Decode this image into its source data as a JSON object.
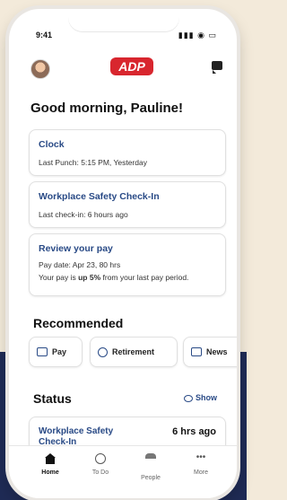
{
  "status_bar": {
    "time": "9:41",
    "icons": "▮▮▮ ◉ ▭"
  },
  "header": {
    "logo_text": "ADP"
  },
  "greeting": "Good morning, Pauline!",
  "cards": {
    "clock": {
      "title": "Clock",
      "subtitle": "Last Punch: 5:15 PM, Yesterday"
    },
    "safety": {
      "title": "Workplace Safety Check-In",
      "subtitle": "Last check-in: 6 hours ago"
    },
    "pay": {
      "title": "Review your pay",
      "line1": "Pay date: Apr 23, 80 hrs",
      "line2_prefix": "Your pay is ",
      "line2_bold": "up 5%",
      "line2_suffix": " from your last pay period."
    }
  },
  "recommended": {
    "title": "Recommended",
    "chips": [
      {
        "label": "Pay"
      },
      {
        "label": "Retirement"
      },
      {
        "label": "News"
      }
    ]
  },
  "status_section": {
    "title": "Status",
    "show_label": "Show",
    "item": {
      "title": "Workplace Safety Check-In",
      "time": "6 hrs ago"
    }
  },
  "tabs": [
    {
      "label": "Home"
    },
    {
      "label": "To Do"
    },
    {
      "label": "People"
    },
    {
      "label": "More"
    }
  ],
  "colors": {
    "brand": "#d8262e",
    "link": "#294a86",
    "background": "#f3eada",
    "band": "#1f2b55"
  }
}
